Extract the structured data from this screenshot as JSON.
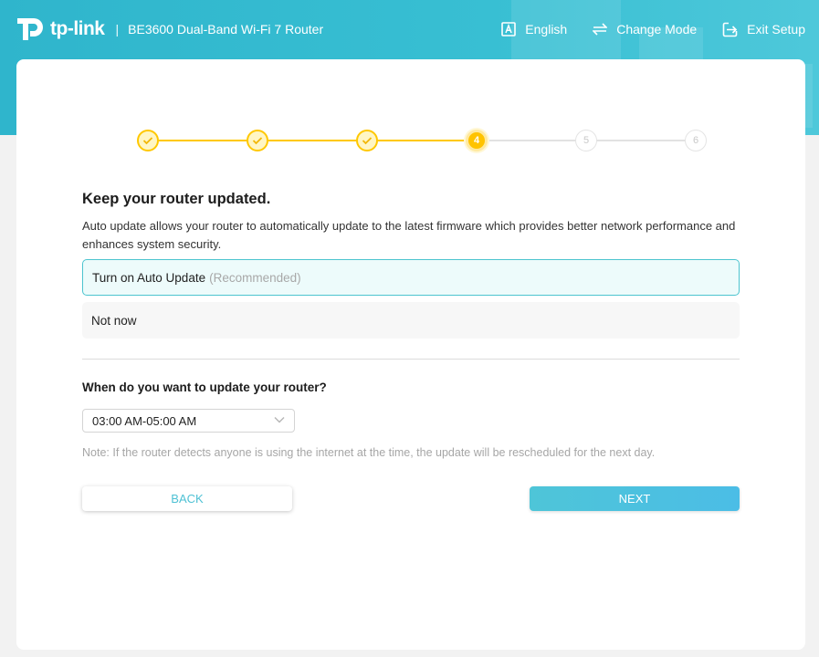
{
  "header": {
    "logo_text": "tp-link",
    "separator": "|",
    "model": "BE3600 Dual-Band Wi-Fi 7 Router",
    "language_label": "English",
    "change_mode_label": "Change Mode",
    "exit_setup_label": "Exit Setup"
  },
  "stepper": {
    "steps": [
      {
        "label": "",
        "state": "done"
      },
      {
        "label": "",
        "state": "done"
      },
      {
        "label": "",
        "state": "done"
      },
      {
        "label": "4",
        "state": "current"
      },
      {
        "label": "5",
        "state": "todo"
      },
      {
        "label": "6",
        "state": "todo"
      }
    ]
  },
  "content": {
    "title": "Keep your router updated.",
    "description": "Auto update allows your router to automatically update to the latest firmware which provides better network performance and enhances system security.",
    "options": [
      {
        "label": "Turn on Auto Update",
        "hint": "(Recommended)",
        "selected": true
      },
      {
        "label": "Not now",
        "hint": "",
        "selected": false
      }
    ],
    "schedule_question": "When do you want to update your router?",
    "schedule_value": "03:00 AM-05:00 AM",
    "note": "Note: If the router detects anyone is using the internet at the time, the update will be rescheduled for the next day.",
    "back_label": "BACK",
    "next_label": "NEXT"
  },
  "colors": {
    "brand_teal": "#38bfd3",
    "step_yellow": "#ffc300",
    "selected_border": "#4cc4cf"
  }
}
